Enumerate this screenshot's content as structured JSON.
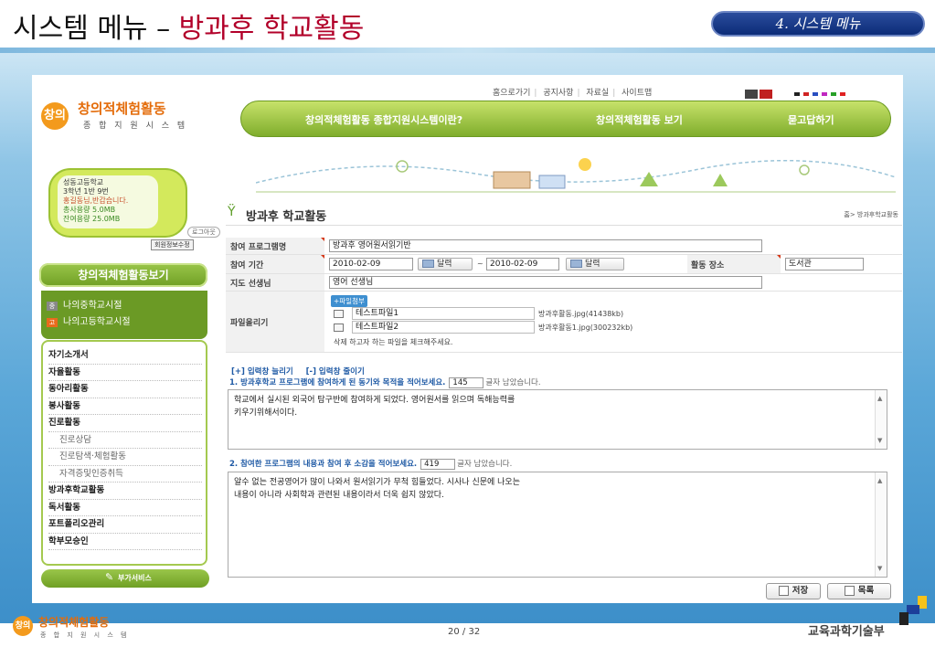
{
  "slide": {
    "title_black": "시스템 메뉴 – ",
    "title_red": "방과후 학교활동",
    "section": "4. 시스템 메뉴",
    "page": "20 / 32",
    "ministry": "교육과학기술부"
  },
  "site": {
    "logo_title": "창의적체험활동",
    "logo_sub": "종 합 지 원 시 스 템",
    "logo_mark": "창의",
    "top_links": [
      "홈으로가기",
      "공지사항",
      "자료실",
      "사이트맵"
    ],
    "main_nav": [
      "창의적체험활동 종합지원시스템이란?",
      "창의적체험활동 보기",
      "묻고답하기"
    ]
  },
  "profile": {
    "school": "성동고등학교",
    "class": "3학년 1반 9번",
    "greeting": "홍길동님,반갑습니다.",
    "total_capacity": "총사용량 5.0MB",
    "remaining_capacity": "잔여용량 25.0MB",
    "logout": "로그아웃",
    "member_edit": "회원정보수정"
  },
  "sidebar": {
    "header": "창의적체험활동보기",
    "quick_links": [
      {
        "tag": "중",
        "label": "나의중학교시절"
      },
      {
        "tag": "고",
        "label": "나의고등학교시절"
      }
    ],
    "menu": [
      {
        "label": "자기소개서",
        "sub": false
      },
      {
        "label": "자율활동",
        "sub": false
      },
      {
        "label": "동아리활동",
        "sub": false
      },
      {
        "label": "봉사활동",
        "sub": false
      },
      {
        "label": "진로활동",
        "sub": false
      },
      {
        "label": "진로상담",
        "sub": true
      },
      {
        "label": "진로탐색·체험활동",
        "sub": true
      },
      {
        "label": "자격증및인증취득",
        "sub": true
      },
      {
        "label": "방과후학교활동",
        "sub": false
      },
      {
        "label": "독서활동",
        "sub": false
      },
      {
        "label": "포트폴리오관리",
        "sub": false
      },
      {
        "label": "학부모승인",
        "sub": false
      }
    ],
    "extra_service": "부가서비스"
  },
  "content": {
    "title": "방과후 학교활동",
    "breadcrumb": "홈> 방과후학교활동",
    "program_label": "참여 프로그램명",
    "program_value": "방과후 영어원서읽기반",
    "period_label": "참여 기간",
    "start_date": "2010-02-09",
    "end_date": "2010-02-09",
    "calendar_label": "달력",
    "range_sep": "~",
    "place_label": "활동 장소",
    "place_value": "도서관",
    "teacher_label": "지도 선생님",
    "teacher_value": "영어 선생님",
    "file_label": "파일올리기",
    "attach_button": "+파일첨부",
    "files": [
      {
        "name": "테스트파일1",
        "info": "방과후활동.jpg(41438kb)"
      },
      {
        "name": "테스트파일2",
        "info": "방과후활동1.jpg(300232kb)"
      }
    ],
    "file_hint": "삭제 하고자 하는 파일을 체크해주세요.",
    "toggle_expand": "[+] 입력창 늘리기",
    "toggle_shrink": "[-] 입력창 줄이기",
    "q1": {
      "title": "1. 방과후학교 프로그램에 참여하게 된 동기와 목적을 적어보세요.",
      "count": "145",
      "count_suffix": "글자 남았습니다.",
      "answer": [
        "학교에서 실시된 외국어 탐구반에 참여하게 되었다. 영어원서를 읽으며 독해능력를",
        "키우기위해서이다."
      ]
    },
    "q2": {
      "title": "2. 참여한 프로그램의 내용과 참여 후 소감을 적어보세요.",
      "count": "419",
      "count_suffix": "글자 남았습니다.",
      "answer": [
        "알수 없는 전공영어가 많이 나와서 원서읽기가 무척 힘들었다. 시사나 신문에 나오는",
        "내용이 아니라 사회학과 관련된 내용이라서 더욱 쉽지 않았다."
      ]
    },
    "save": "저장",
    "list": "목록"
  },
  "colors": {
    "title_red": "#b2002a",
    "nav_green": "#7fad2c",
    "link_blue": "#1f5aa5",
    "accent_orange": "#e46c0a"
  }
}
